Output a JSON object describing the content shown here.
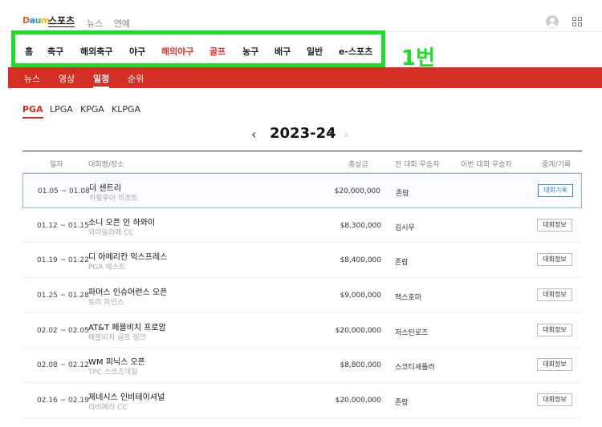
{
  "header": {
    "logo": "Daum",
    "service": "스포츠",
    "topnav": [
      "뉴스",
      "연예"
    ]
  },
  "category_nav": [
    "홈",
    "축구",
    "해외축구",
    "야구",
    "해외야구",
    "골프",
    "농구",
    "배구",
    "일반",
    "e-스포츠"
  ],
  "overlay_label": "1번",
  "sub_nav": [
    "뉴스",
    "영상",
    "일정",
    "순위"
  ],
  "tours": [
    "PGA",
    "LPGA",
    "KPGA",
    "KLPGA"
  ],
  "season": {
    "title": "2023-24"
  },
  "table": {
    "columns": {
      "date": "일자",
      "name": "대회명/장소",
      "purse": "총상금",
      "prev_winner": "전 대회 우승자",
      "this_winner": "이번 대회 우승자",
      "record": "중계/기록"
    },
    "rows": [
      {
        "date": "01.05 ~ 01.08",
        "name": "더 센트리",
        "venue": "카팔루아 리조트",
        "purse": "$20,000,000",
        "winner": "존람",
        "button": "대회기록",
        "highlight": true
      },
      {
        "date": "01.12 ~ 01.15",
        "name": "소니 오픈 인 하와이",
        "venue": "와이알라에 CC",
        "purse": "$8,300,000",
        "winner": "김시우",
        "button": "대회정보"
      },
      {
        "date": "01.19 ~ 01.22",
        "name": "디 아메리칸 익스프레스",
        "venue": "PGA 웨스트",
        "purse": "$8,400,000",
        "winner": "존람",
        "button": "대회정보"
      },
      {
        "date": "01.25 ~ 01.28",
        "name": "파머스 인슈어런스 오픈",
        "venue": "토리 파인스",
        "purse": "$9,000,000",
        "winner": "맥스호마",
        "button": "대회정보"
      },
      {
        "date": "02.02 ~ 02.05",
        "name": "AT&T 페블비치 프로암",
        "venue": "페블비치 골프 링크",
        "purse": "$20,000,000",
        "winner": "저스틴로즈",
        "button": "대회정보"
      },
      {
        "date": "02.08 ~ 02.12",
        "name": "WM 피닉스 오픈",
        "venue": "TPC 스코츠데일",
        "purse": "$8,800,000",
        "winner": "스코티셰플러",
        "button": "대회정보"
      },
      {
        "date": "02.16 ~ 02.19",
        "name": "제네시스 인비테이셔널",
        "venue": "리비에라 CC",
        "purse": "$20,000,000",
        "winner": "존람",
        "button": "대회정보"
      }
    ]
  }
}
